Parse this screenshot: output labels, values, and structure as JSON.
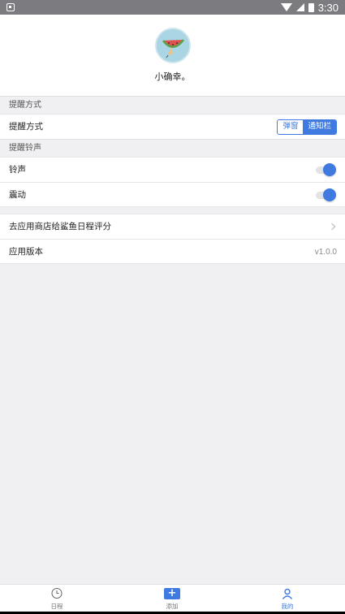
{
  "status_bar": {
    "time": "3:30"
  },
  "profile": {
    "username": "小确幸。"
  },
  "reminder_section": {
    "header": "提醒方式",
    "row_label": "提醒方式",
    "options": [
      "弹窗",
      "通知栏"
    ],
    "selected": "弹窗"
  },
  "ringtone_section": {
    "header": "提醒铃声",
    "rows": [
      {
        "label": "铃声",
        "enabled": true
      },
      {
        "label": "震动",
        "enabled": true
      }
    ]
  },
  "misc": {
    "rate_label": "去应用商店给鲨鱼日程评分",
    "version_label": "应用版本",
    "version_value": "v1.0.0"
  },
  "tab_bar": {
    "tabs": [
      {
        "label": "日程",
        "icon": "clock-icon",
        "active": false
      },
      {
        "label": "添加",
        "icon": "plus-icon",
        "active": false
      },
      {
        "label": "我的",
        "icon": "user-icon",
        "active": true
      }
    ]
  },
  "colors": {
    "accent": "#3f7ae0",
    "status_bar": "#7b7b80",
    "background": "#f0f0f2"
  }
}
